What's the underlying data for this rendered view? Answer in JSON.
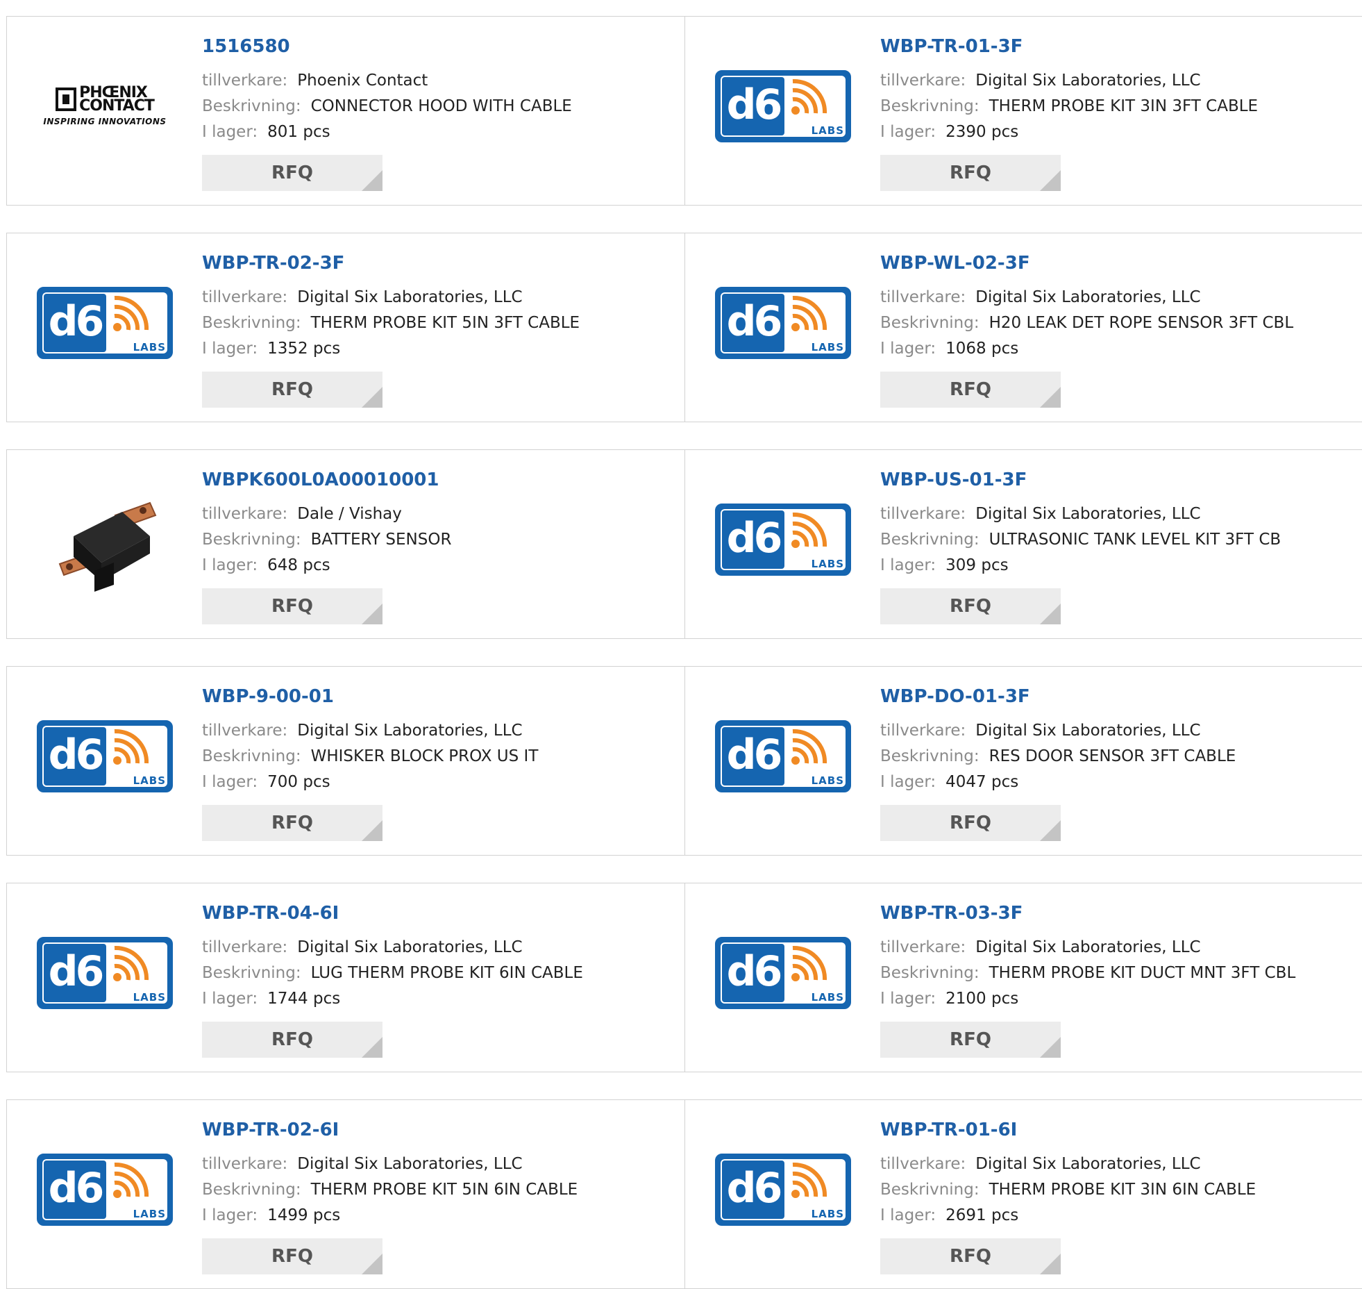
{
  "labels": {
    "manufacturer": "tillverkare:",
    "description": "Beskrivning:",
    "stock": "I lager:",
    "rfq": "RFQ"
  },
  "colors": {
    "part_link": "#1f5fa6",
    "label_gray": "#8a8a8a",
    "button_bg": "#ececec",
    "d6_blue": "#1565b0",
    "d6_orange": "#f08a24"
  },
  "logos": {
    "phoenix": {
      "line1": "PHŒNIX",
      "line2": "CONTACT",
      "tagline": "INSPIRING INNOVATIONS"
    },
    "d6": {
      "mark": "d6",
      "sub": "LABS"
    }
  },
  "products": [
    {
      "part": "1516580",
      "manufacturer": "Phoenix Contact",
      "description": "CONNECTOR HOOD WITH CABLE",
      "stock": "801 pcs",
      "logo": "phoenix"
    },
    {
      "part": "WBP-TR-01-3F",
      "manufacturer": "Digital Six Laboratories, LLC",
      "description": "THERM PROBE KIT 3IN 3FT CABLE",
      "stock": "2390 pcs",
      "logo": "d6"
    },
    {
      "part": "WBP-TR-02-3F",
      "manufacturer": "Digital Six Laboratories, LLC",
      "description": "THERM PROBE KIT 5IN 3FT CABLE",
      "stock": "1352 pcs",
      "logo": "d6"
    },
    {
      "part": "WBP-WL-02-3F",
      "manufacturer": "Digital Six Laboratories, LLC",
      "description": "H20 LEAK DET ROPE SENSOR 3FT CBL",
      "stock": "1068 pcs",
      "logo": "d6"
    },
    {
      "part": "WBPK600L0A00010001",
      "manufacturer": "Dale / Vishay",
      "description": "BATTERY SENSOR",
      "stock": "648 pcs",
      "logo": "sensor"
    },
    {
      "part": "WBP-US-01-3F",
      "manufacturer": "Digital Six Laboratories, LLC",
      "description": "ULTRASONIC TANK LEVEL KIT 3FT CB",
      "stock": "309 pcs",
      "logo": "d6"
    },
    {
      "part": "WBP-9-00-01",
      "manufacturer": "Digital Six Laboratories, LLC",
      "description": "WHISKER BLOCK PROX US IT",
      "stock": "700 pcs",
      "logo": "d6"
    },
    {
      "part": "WBP-DO-01-3F",
      "manufacturer": "Digital Six Laboratories, LLC",
      "description": "RES DOOR SENSOR 3FT CABLE",
      "stock": "4047 pcs",
      "logo": "d6"
    },
    {
      "part": "WBP-TR-04-6I",
      "manufacturer": "Digital Six Laboratories, LLC",
      "description": "LUG THERM PROBE KIT 6IN CABLE",
      "stock": "1744 pcs",
      "logo": "d6"
    },
    {
      "part": "WBP-TR-03-3F",
      "manufacturer": "Digital Six Laboratories, LLC",
      "description": "THERM PROBE KIT DUCT MNT 3FT CBL",
      "stock": "2100 pcs",
      "logo": "d6"
    },
    {
      "part": "WBP-TR-02-6I",
      "manufacturer": "Digital Six Laboratories, LLC",
      "description": "THERM PROBE KIT 5IN 6IN CABLE",
      "stock": "1499 pcs",
      "logo": "d6"
    },
    {
      "part": "WBP-TR-01-6I",
      "manufacturer": "Digital Six Laboratories, LLC",
      "description": "THERM PROBE KIT 3IN 6IN CABLE",
      "stock": "2691 pcs",
      "logo": "d6"
    }
  ]
}
